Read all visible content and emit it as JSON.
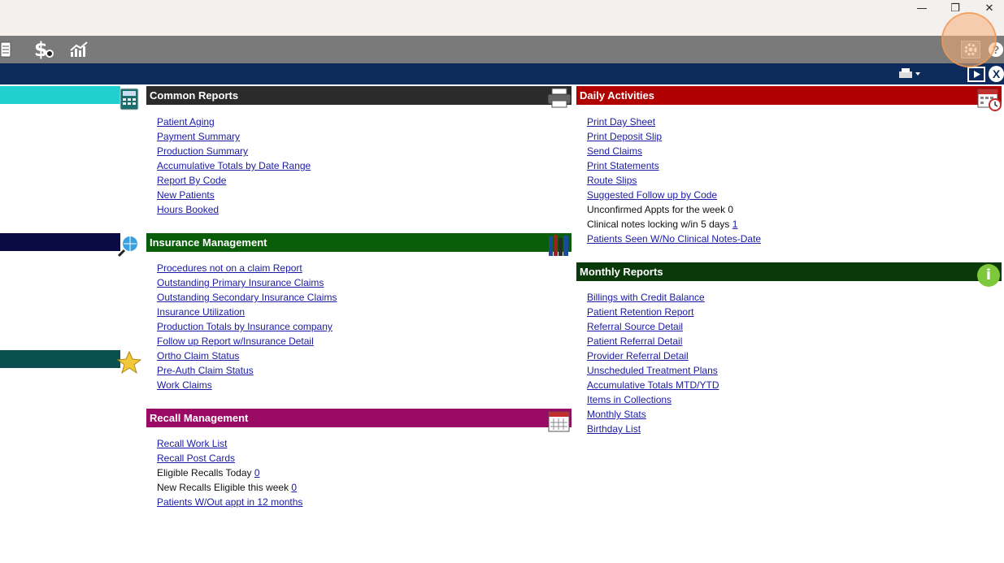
{
  "window": {
    "minimize_glyph": "—",
    "restore_glyph": "❐",
    "close_glyph": "✕"
  },
  "toolbar": {
    "icons": [
      "document-icon",
      "dollar-icon",
      "chart-icon",
      "gear-icon",
      "help-icon"
    ],
    "dollar_glyph": "$",
    "help_glyph": "?"
  },
  "navbar": {
    "icons": [
      "printer-dropdown-icon",
      "play-icon",
      "close-circle-icon"
    ],
    "close_glyph": "X"
  },
  "colors": {
    "toolbar": "#7a7a7a",
    "navbar": "#0d2a5c",
    "common_reports": "#2b2b2b",
    "insurance_management": "#0a5e0a",
    "recall_management": "#9a0a64",
    "daily_activities": "#b00000",
    "monthly_reports": "#0a3a0a",
    "link": "#1a1aa6",
    "side_cyan": "#20d0d0",
    "side_navy": "#0b0b44",
    "side_teal": "#0a5050"
  },
  "common_reports": {
    "title": "Common Reports",
    "links": [
      "Patient Aging",
      "Payment Summary",
      "Production Summary",
      "Accumulative Totals by Date Range",
      "Report By Code",
      "New Patients",
      "Hours Booked"
    ]
  },
  "insurance_management": {
    "title": "Insurance Management",
    "links": [
      "Procedures not on a claim Report",
      "Outstanding Primary Insurance Claims",
      "Outstanding Secondary Insurance Claims",
      "Insurance Utilization",
      "Production Totals by Insurance company",
      "Follow up Report w/Insurance Detail",
      "Ortho Claim Status",
      "Pre-Auth Claim Status",
      "Work Claims"
    ]
  },
  "recall_management": {
    "title": "Recall Management",
    "links": [
      "Recall Work List",
      "Recall Post Cards"
    ],
    "eligible_today_label": "Eligible Recalls Today",
    "eligible_today_count": "0",
    "new_eligible_label": "New Recalls Eligible this week",
    "new_eligible_count": "0",
    "no_appt_link": "Patients W/Out appt in 12 months"
  },
  "daily_activities": {
    "title": "Daily Activities",
    "links": [
      "Print Day Sheet",
      "Print Deposit Slip",
      "Send Claims",
      "Print Statements",
      "Route Slips",
      "Suggested Follow up by Code"
    ],
    "unconfirmed_label": "Unconfirmed Appts for the week 0",
    "clinical_locking_label": "Clinical notes locking w/in 5 days",
    "clinical_locking_count": "1",
    "no_notes_link": "Patients Seen W/No Clinical Notes-Date"
  },
  "monthly_reports": {
    "title": "Monthly Reports",
    "links": [
      "Billings with Credit Balance",
      "Patient Retention Report",
      "Referral Source Detail",
      "Patient Referral Detail",
      "Provider Referral Detail",
      "Unscheduled Treatment Plans",
      "Accumulative Totals MTD/YTD",
      "Items in Collections",
      "Monthly Stats",
      "Birthday List"
    ]
  }
}
